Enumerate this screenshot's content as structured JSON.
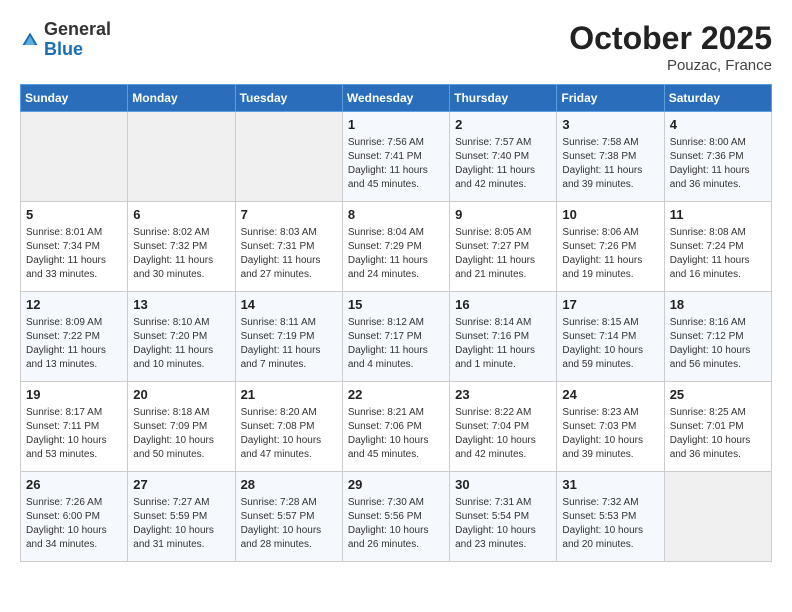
{
  "header": {
    "logo_general": "General",
    "logo_blue": "Blue",
    "month_title": "October 2025",
    "location": "Pouzac, France"
  },
  "weekdays": [
    "Sunday",
    "Monday",
    "Tuesday",
    "Wednesday",
    "Thursday",
    "Friday",
    "Saturday"
  ],
  "weeks": [
    [
      {
        "day": "",
        "lines": []
      },
      {
        "day": "",
        "lines": []
      },
      {
        "day": "",
        "lines": []
      },
      {
        "day": "1",
        "lines": [
          "Sunrise: 7:56 AM",
          "Sunset: 7:41 PM",
          "Daylight: 11 hours",
          "and 45 minutes."
        ]
      },
      {
        "day": "2",
        "lines": [
          "Sunrise: 7:57 AM",
          "Sunset: 7:40 PM",
          "Daylight: 11 hours",
          "and 42 minutes."
        ]
      },
      {
        "day": "3",
        "lines": [
          "Sunrise: 7:58 AM",
          "Sunset: 7:38 PM",
          "Daylight: 11 hours",
          "and 39 minutes."
        ]
      },
      {
        "day": "4",
        "lines": [
          "Sunrise: 8:00 AM",
          "Sunset: 7:36 PM",
          "Daylight: 11 hours",
          "and 36 minutes."
        ]
      }
    ],
    [
      {
        "day": "5",
        "lines": [
          "Sunrise: 8:01 AM",
          "Sunset: 7:34 PM",
          "Daylight: 11 hours",
          "and 33 minutes."
        ]
      },
      {
        "day": "6",
        "lines": [
          "Sunrise: 8:02 AM",
          "Sunset: 7:32 PM",
          "Daylight: 11 hours",
          "and 30 minutes."
        ]
      },
      {
        "day": "7",
        "lines": [
          "Sunrise: 8:03 AM",
          "Sunset: 7:31 PM",
          "Daylight: 11 hours",
          "and 27 minutes."
        ]
      },
      {
        "day": "8",
        "lines": [
          "Sunrise: 8:04 AM",
          "Sunset: 7:29 PM",
          "Daylight: 11 hours",
          "and 24 minutes."
        ]
      },
      {
        "day": "9",
        "lines": [
          "Sunrise: 8:05 AM",
          "Sunset: 7:27 PM",
          "Daylight: 11 hours",
          "and 21 minutes."
        ]
      },
      {
        "day": "10",
        "lines": [
          "Sunrise: 8:06 AM",
          "Sunset: 7:26 PM",
          "Daylight: 11 hours",
          "and 19 minutes."
        ]
      },
      {
        "day": "11",
        "lines": [
          "Sunrise: 8:08 AM",
          "Sunset: 7:24 PM",
          "Daylight: 11 hours",
          "and 16 minutes."
        ]
      }
    ],
    [
      {
        "day": "12",
        "lines": [
          "Sunrise: 8:09 AM",
          "Sunset: 7:22 PM",
          "Daylight: 11 hours",
          "and 13 minutes."
        ]
      },
      {
        "day": "13",
        "lines": [
          "Sunrise: 8:10 AM",
          "Sunset: 7:20 PM",
          "Daylight: 11 hours",
          "and 10 minutes."
        ]
      },
      {
        "day": "14",
        "lines": [
          "Sunrise: 8:11 AM",
          "Sunset: 7:19 PM",
          "Daylight: 11 hours",
          "and 7 minutes."
        ]
      },
      {
        "day": "15",
        "lines": [
          "Sunrise: 8:12 AM",
          "Sunset: 7:17 PM",
          "Daylight: 11 hours",
          "and 4 minutes."
        ]
      },
      {
        "day": "16",
        "lines": [
          "Sunrise: 8:14 AM",
          "Sunset: 7:16 PM",
          "Daylight: 11 hours",
          "and 1 minute."
        ]
      },
      {
        "day": "17",
        "lines": [
          "Sunrise: 8:15 AM",
          "Sunset: 7:14 PM",
          "Daylight: 10 hours",
          "and 59 minutes."
        ]
      },
      {
        "day": "18",
        "lines": [
          "Sunrise: 8:16 AM",
          "Sunset: 7:12 PM",
          "Daylight: 10 hours",
          "and 56 minutes."
        ]
      }
    ],
    [
      {
        "day": "19",
        "lines": [
          "Sunrise: 8:17 AM",
          "Sunset: 7:11 PM",
          "Daylight: 10 hours",
          "and 53 minutes."
        ]
      },
      {
        "day": "20",
        "lines": [
          "Sunrise: 8:18 AM",
          "Sunset: 7:09 PM",
          "Daylight: 10 hours",
          "and 50 minutes."
        ]
      },
      {
        "day": "21",
        "lines": [
          "Sunrise: 8:20 AM",
          "Sunset: 7:08 PM",
          "Daylight: 10 hours",
          "and 47 minutes."
        ]
      },
      {
        "day": "22",
        "lines": [
          "Sunrise: 8:21 AM",
          "Sunset: 7:06 PM",
          "Daylight: 10 hours",
          "and 45 minutes."
        ]
      },
      {
        "day": "23",
        "lines": [
          "Sunrise: 8:22 AM",
          "Sunset: 7:04 PM",
          "Daylight: 10 hours",
          "and 42 minutes."
        ]
      },
      {
        "day": "24",
        "lines": [
          "Sunrise: 8:23 AM",
          "Sunset: 7:03 PM",
          "Daylight: 10 hours",
          "and 39 minutes."
        ]
      },
      {
        "day": "25",
        "lines": [
          "Sunrise: 8:25 AM",
          "Sunset: 7:01 PM",
          "Daylight: 10 hours",
          "and 36 minutes."
        ]
      }
    ],
    [
      {
        "day": "26",
        "lines": [
          "Sunrise: 7:26 AM",
          "Sunset: 6:00 PM",
          "Daylight: 10 hours",
          "and 34 minutes."
        ]
      },
      {
        "day": "27",
        "lines": [
          "Sunrise: 7:27 AM",
          "Sunset: 5:59 PM",
          "Daylight: 10 hours",
          "and 31 minutes."
        ]
      },
      {
        "day": "28",
        "lines": [
          "Sunrise: 7:28 AM",
          "Sunset: 5:57 PM",
          "Daylight: 10 hours",
          "and 28 minutes."
        ]
      },
      {
        "day": "29",
        "lines": [
          "Sunrise: 7:30 AM",
          "Sunset: 5:56 PM",
          "Daylight: 10 hours",
          "and 26 minutes."
        ]
      },
      {
        "day": "30",
        "lines": [
          "Sunrise: 7:31 AM",
          "Sunset: 5:54 PM",
          "Daylight: 10 hours",
          "and 23 minutes."
        ]
      },
      {
        "day": "31",
        "lines": [
          "Sunrise: 7:32 AM",
          "Sunset: 5:53 PM",
          "Daylight: 10 hours",
          "and 20 minutes."
        ]
      },
      {
        "day": "",
        "lines": []
      }
    ]
  ]
}
